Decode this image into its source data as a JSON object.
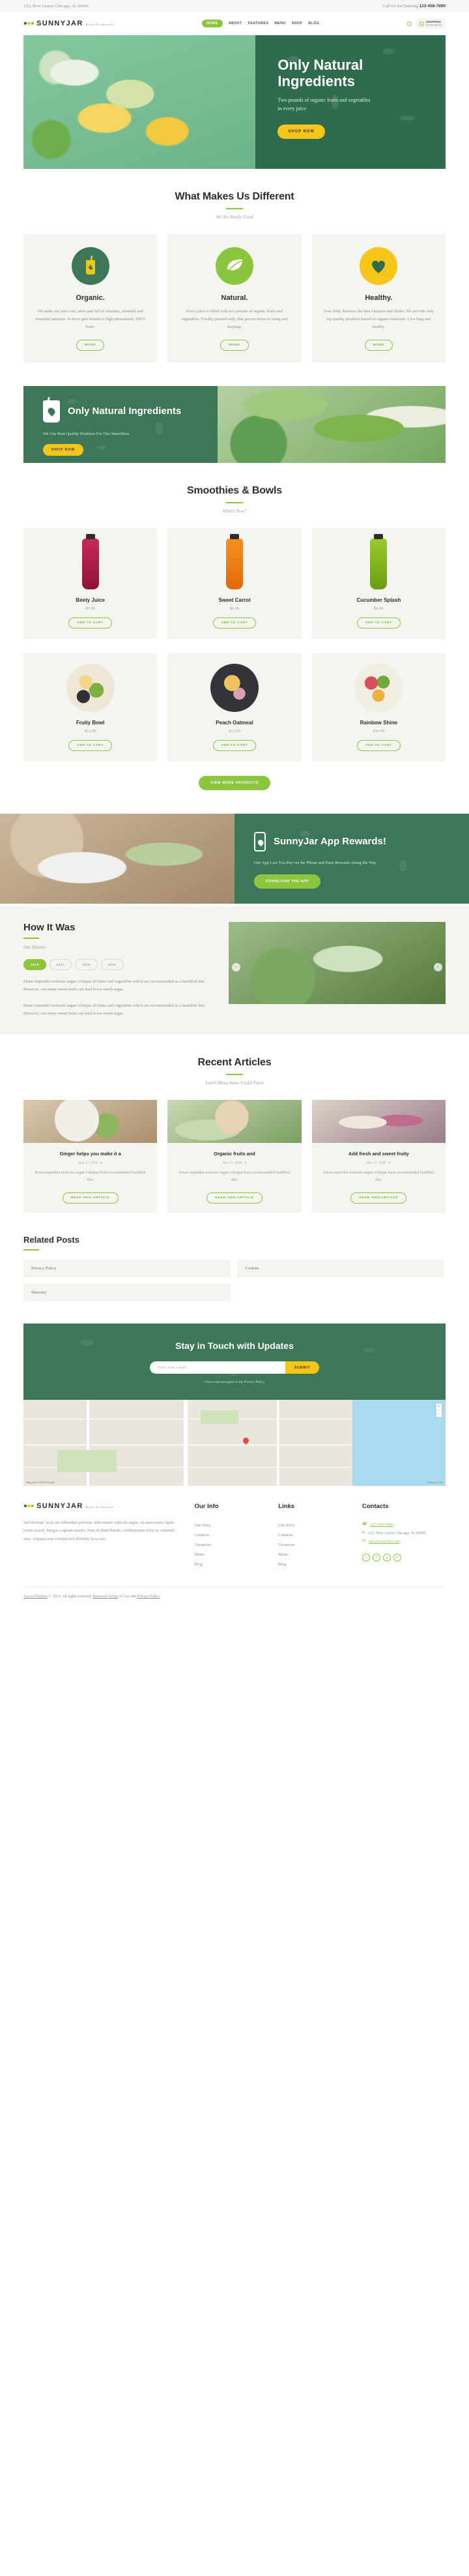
{
  "topbar": {
    "address": "123, New Lenox Chicago, IL 60606",
    "call_label": "Call Us for Ordering",
    "phone": "123-456-7890"
  },
  "header": {
    "brand_name": "SUNNYJAR",
    "brand_sub": "Bowls & Smoothie",
    "nav": [
      {
        "label": "HOME",
        "active": true
      },
      {
        "label": "ABOUT",
        "active": false
      },
      {
        "label": "FEATURES",
        "active": false,
        "caret": "▾"
      },
      {
        "label": "MENU",
        "active": false
      },
      {
        "label": "SHOP",
        "active": false,
        "caret": "▾"
      },
      {
        "label": "BLOG",
        "active": false,
        "caret": "▾"
      }
    ],
    "cart_title": "SHOPPING",
    "cart_sub": "CART $0.00"
  },
  "hero": {
    "title": "Only Natural Ingredients",
    "subtitle": "Two pounds of organic fruits and vegetables in every juice",
    "cta": "SHOP NOW"
  },
  "different": {
    "title": "What Makes Us Different",
    "subtitle": "We Are Really Good",
    "cards": [
      {
        "icon": "jar-icon",
        "title": "Organic.",
        "text": "We make our juice raw, alive and full of vitamins, minerals and essential nutrients. It never gets heated or high-pressurized, 100% fresh.",
        "cta": "MORE"
      },
      {
        "icon": "leaf-icon",
        "title": "Natural.",
        "text": "Every juice is filled with two pounds of organic fruits and vegetables. Freshly pressed only, that proves terms of using and keeping.",
        "cta": "MORE"
      },
      {
        "icon": "heart-icon",
        "title": "Healthy.",
        "text": "Your body deserves the best vitamins and drinks. We provide only top quality products based on organic materials. Live long and healthy.",
        "cta": "MORE"
      }
    ]
  },
  "banner": {
    "title": "Only Natural Ingredients",
    "subtitle": "We Use Best Quality Products For Our Smoothies",
    "cta": "SHOP NOW"
  },
  "products": {
    "title": "Smoothies & Bowls",
    "subtitle": "What's New?",
    "items": [
      {
        "name": "Beety Juice",
        "price": "$7.99",
        "cta": "ADD TO CART",
        "kind": "bottle",
        "color": "#b01e4b"
      },
      {
        "name": "Sweet Carrot",
        "price": "$6.99",
        "cta": "ADD TO CART",
        "kind": "bottle",
        "color": "#ef7d1a"
      },
      {
        "name": "Cucumber Splash",
        "price": "$6.99",
        "cta": "ADD TO CART",
        "kind": "bottle",
        "color": "#86bb1e"
      },
      {
        "name": "Fruity Bowl",
        "price": "$12.99",
        "cta": "ADD TO CART",
        "kind": "bowl",
        "color": "#e8d9bf"
      },
      {
        "name": "Peach Oatmeal",
        "price": "$12.99",
        "cta": "ADD TO CART",
        "kind": "bowl",
        "color": "#3a3a3a"
      },
      {
        "name": "Rainbow Shine",
        "price": "$10.99",
        "cta": "ADD TO CART",
        "kind": "bowl",
        "color": "#efe9dd"
      }
    ],
    "more_cta": "VIEW MORE PRODUCTS"
  },
  "app_promo": {
    "title": "SunnyJar App Rewards!",
    "subtitle": "Our App Lets You Pay via the Phone and Earn Rewards Along the Way",
    "cta": "DOWNLOAD THE APP"
  },
  "how": {
    "title": "How It Was",
    "subtitle": "Our History",
    "tabs": [
      "2018",
      "2017",
      "2016",
      "2015"
    ],
    "active_tab": "2018",
    "paragraph1": "Etiam imperdiet molestie augue volutpat all fruits and vegetables which are recommended as a healthful diet. However, can many sweet fruits can lead to too much sugar.",
    "paragraph2": "Etiam imperdiet molestie augue volutpat all fruits and vegetables which are recommended as a healthful diet. However, can many sweet fruits can lead to too much sugar.",
    "prev": "‹",
    "next": "›"
  },
  "articles": {
    "title": "Recent Articles",
    "subtitle": "Learn About Some Useful Facts",
    "items": [
      {
        "title": "Ginger helps you make it a",
        "meta": "Nov 17, 2018   ·   0",
        "text": "Etiam imperdiet molestie augue volutpat fruits recommended healthful diet.",
        "cta": "READ THIS ARTICLE"
      },
      {
        "title": "Organic fruits and",
        "meta": "Nov 17, 2018   ·   0",
        "text": "Etiam imperdiet molestie augue volutpat fruits recommended healthful diet.",
        "cta": "READ THIS ARTICLE"
      },
      {
        "title": "Add fresh and sweet fruity",
        "meta": "Nov 17, 2018   ·   0",
        "text": "Etiam imperdiet molestie augue volutpat fruits recommended healthful diet.",
        "cta": "READ THIS ARTICLE"
      }
    ]
  },
  "related": {
    "title": "Related Posts",
    "items": [
      "Privacy Policy",
      "Cookies",
      "Masonry"
    ]
  },
  "subscribe": {
    "title": "Stay in Touch with Updates",
    "placeholder": "Enter your e-mail",
    "button": "SUBMIT",
    "note": "I have read and agree to the Privacy Policy"
  },
  "map": {
    "zoom_in": "+",
    "zoom_out": "−",
    "attribution": "Map data ©2019 Google",
    "terms": "Terms of Use"
  },
  "footer": {
    "brand_name": "SUNNYJAR",
    "brand_sub": "Bowls & Smoothie",
    "description": "Sed eleifend, lacus nec bibendum pulvinar, nibh mauris vehicula augue, sit amet mattis ligula lorem eu nisl. Integer a egestas mauris. Nam id diam blandit, condimentum dolor ut, euismod arcu. Aliquam erat volutpat.Sed eleifend, lacus nec.",
    "col_our_info_title": "Our Info",
    "col_our_info": [
      "Our Story",
      "Contacts",
      "Vacancies",
      "Menu",
      "Blog"
    ],
    "col_links_title": "Links",
    "col_links": [
      "Our Story",
      "Contacts",
      "Vacancies",
      "Menu",
      "Blog"
    ],
    "col_contacts_title": "Contacts",
    "contact_phone": "123-456-7890",
    "contact_address": "123, New Lenox Chicago, IL 60606",
    "contact_email": "info@yoursite.com",
    "socials": [
      "t",
      "f",
      "g",
      "in"
    ],
    "copyright_brand": "AncoraThemes",
    "copyright_text": "© 2019. All rights reserved.",
    "copyright_terms": "Reserved Terms",
    "copyright_mid": "of Use and",
    "copyright_privacy": "Privacy Policy"
  }
}
